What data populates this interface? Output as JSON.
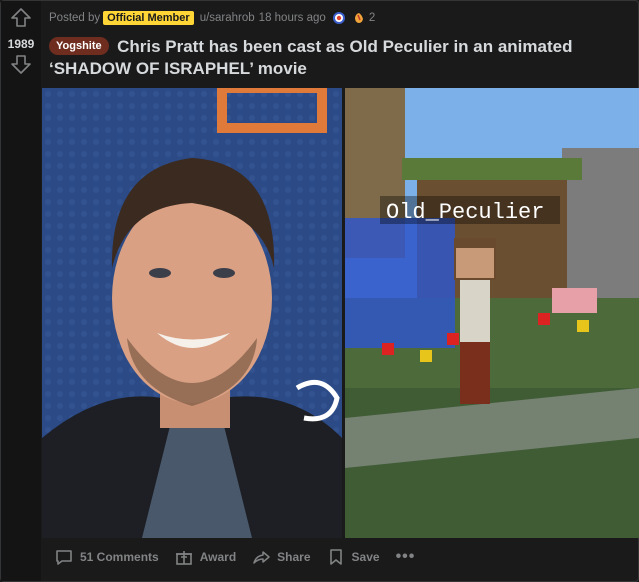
{
  "post": {
    "score": "1989",
    "posted_by_label": "Posted by",
    "badge": "Official Member",
    "author": "u/sarahrob",
    "time": "18 hours ago",
    "award_count": "2",
    "flair": "Yogshite",
    "title": "Chris Pratt has been cast as Old Peculier in an animated ‘SHADOW OF ISRAPHEL’ movie",
    "image_overlay_text": "Old_Peculier"
  },
  "actions": {
    "comments": "51 Comments",
    "award": "Award",
    "share": "Share",
    "save": "Save",
    "more": "•••"
  },
  "colors": {
    "background": "#1a1a1b",
    "badge": "#ffd635",
    "flair": "#6e2d1f",
    "muted": "#818384"
  }
}
